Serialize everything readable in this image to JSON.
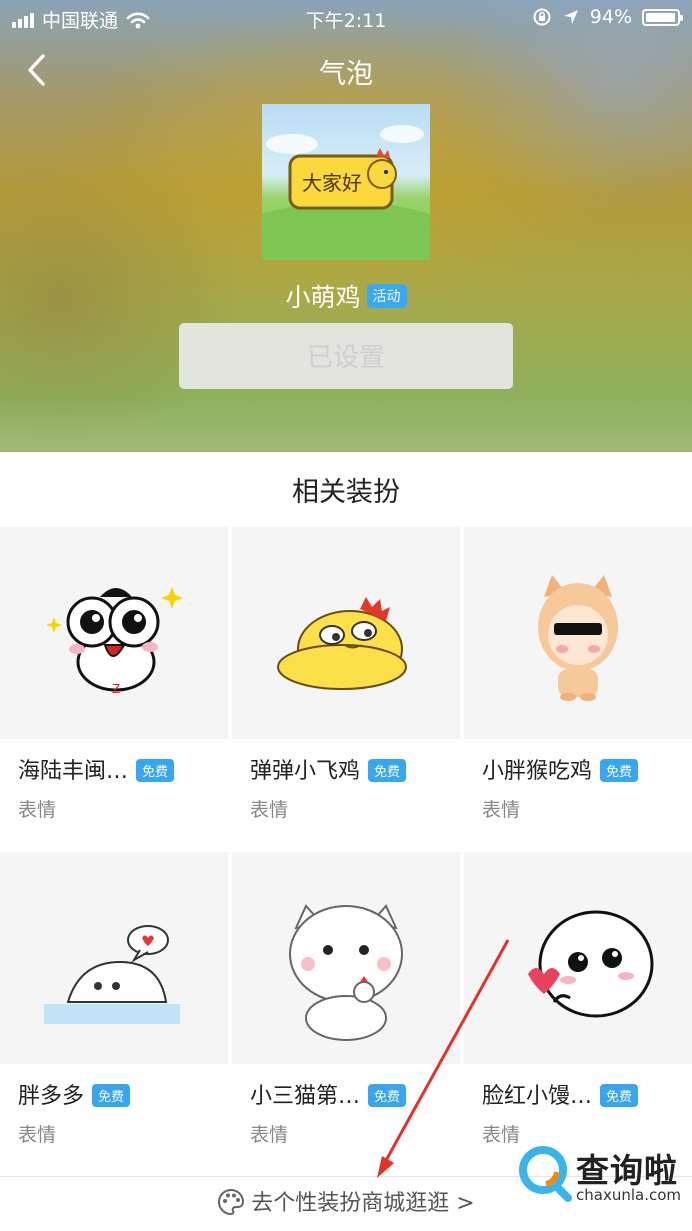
{
  "status_bar": {
    "carrier": "中国联通",
    "time": "下午2:11",
    "battery": "94%"
  },
  "nav": {
    "title": "气泡"
  },
  "preview": {
    "bubble_text": "大家好"
  },
  "item": {
    "name": "小萌鸡",
    "tag": "活动",
    "button_label": "已设置"
  },
  "related": {
    "title": "相关装扮",
    "cards": [
      {
        "name": "海陆丰闽…",
        "badge": "免费",
        "type": "表情"
      },
      {
        "name": "弹弹小飞鸡",
        "badge": "免费",
        "type": "表情"
      },
      {
        "name": "小胖猴吃鸡",
        "badge": "免费",
        "type": "表情"
      },
      {
        "name": "胖多多",
        "badge": "免费",
        "type": "表情"
      },
      {
        "name": "小三猫第…",
        "badge": "免费",
        "type": "表情"
      },
      {
        "name": "脸红小馒…",
        "badge": "免费",
        "type": "表情"
      }
    ]
  },
  "bottom_link": {
    "label": "去个性装扮商城逛逛 >"
  },
  "watermark": {
    "brand": "查询啦",
    "domain": "chaxunla.com"
  },
  "colors": {
    "accent_blue": "#38a5ef",
    "arrow_red": "#e4322b"
  }
}
